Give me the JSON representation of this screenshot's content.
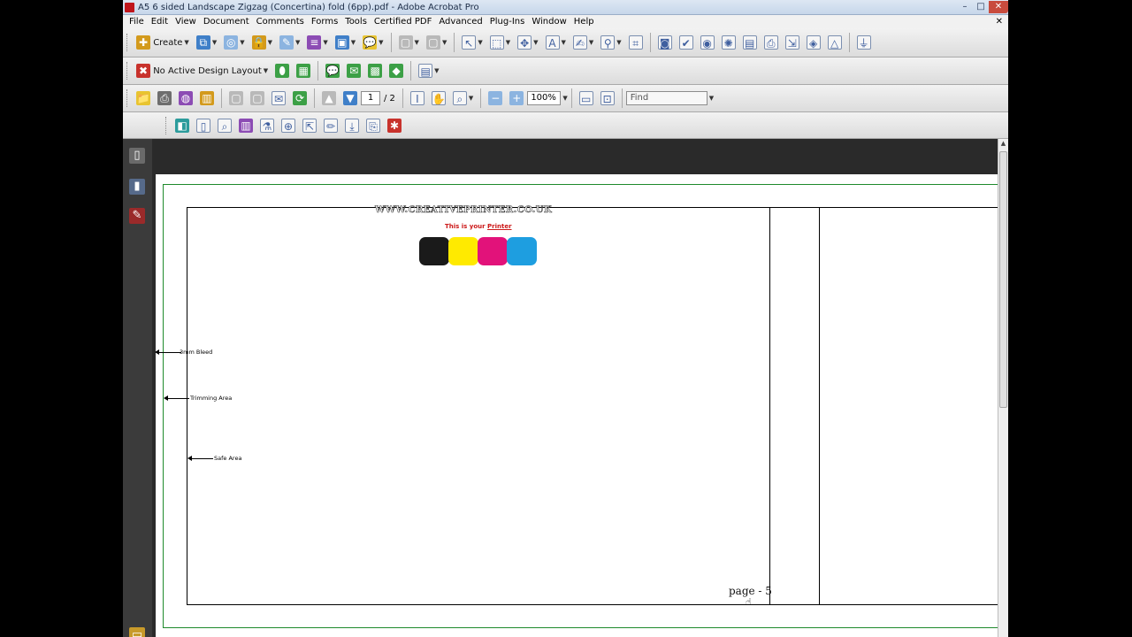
{
  "window": {
    "title": "A5 6 sided Landscape Zigzag (Concertina) fold (6pp).pdf - Adobe Acrobat Pro",
    "minimize": "–",
    "maximize": "□",
    "close": "✕"
  },
  "menu": {
    "items": [
      "File",
      "Edit",
      "View",
      "Document",
      "Comments",
      "Forms",
      "Tools",
      "Certified PDF",
      "Advanced",
      "Plug-Ins",
      "Window",
      "Help"
    ],
    "close_doc": "✕"
  },
  "toolbar1": {
    "create_label": "Create"
  },
  "toolbar2": {
    "design_layout_label": "No Active Design Layout"
  },
  "toolbar3": {
    "page_current": "1",
    "page_total": "/ 2",
    "zoom_value": "100%",
    "find_placeholder": "Find"
  },
  "document": {
    "website": "WWW.CREATIVEPRINTER.CO.UK",
    "printer_prefix": "This is your ",
    "printer_word": "Printer",
    "bleed_label": "3mm Bleed",
    "trimming_label": "Trimming Area",
    "safe_label": "Safe Area",
    "page_label": "page - 5",
    "swatch_colors": [
      "#1a1a1a",
      "#ffea00",
      "#e2127a",
      "#1e9ee0"
    ]
  },
  "colors": {
    "frame_green": "#1f8a2c",
    "nav_bg": "#3b3b3b",
    "doc_bg": "#2a2a2a"
  }
}
